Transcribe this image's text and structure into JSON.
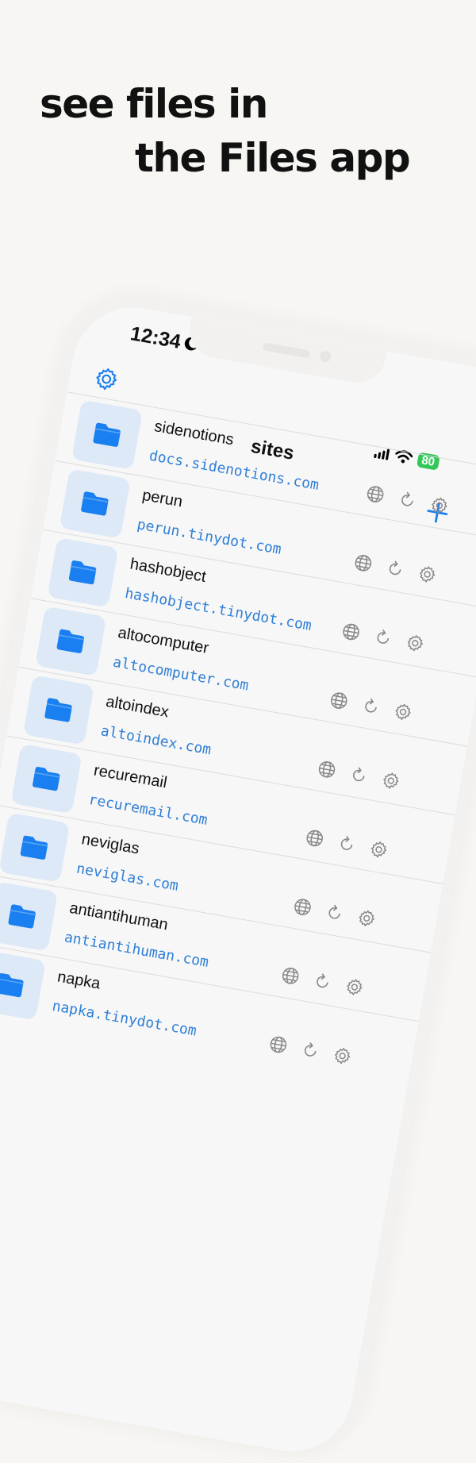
{
  "headline": {
    "line1": "see files in",
    "line2": "the Files app"
  },
  "status_bar": {
    "time": "12:34",
    "battery": "80"
  },
  "nav": {
    "title": "sites"
  },
  "sites": [
    {
      "name": "sidenotions",
      "url": "docs.sidenotions.com"
    },
    {
      "name": "perun",
      "url": "perun.tinydot.com"
    },
    {
      "name": "hashobject",
      "url": "hashobject.tinydot.com"
    },
    {
      "name": "altocomputer",
      "url": "altocomputer.com"
    },
    {
      "name": "altoindex",
      "url": "altoindex.com"
    },
    {
      "name": "recuremail",
      "url": "recuremail.com"
    },
    {
      "name": "neviglas",
      "url": "neviglas.com"
    },
    {
      "name": "antiantihuman",
      "url": "antiantihuman.com"
    },
    {
      "name": "napka",
      "url": "napka.tinydot.com"
    }
  ],
  "icons": {
    "settings": "gear-icon",
    "add": "plus-icon",
    "folder": "folder-icon",
    "open_web": "globe-icon",
    "sync": "refresh-icon",
    "site_settings": "gear-icon"
  },
  "colors": {
    "background": "#f8f6f2",
    "accent": "#1a7ff0",
    "url": "#2f7fd6",
    "folder_tile": "#dde9f7",
    "battery": "#33c759"
  }
}
